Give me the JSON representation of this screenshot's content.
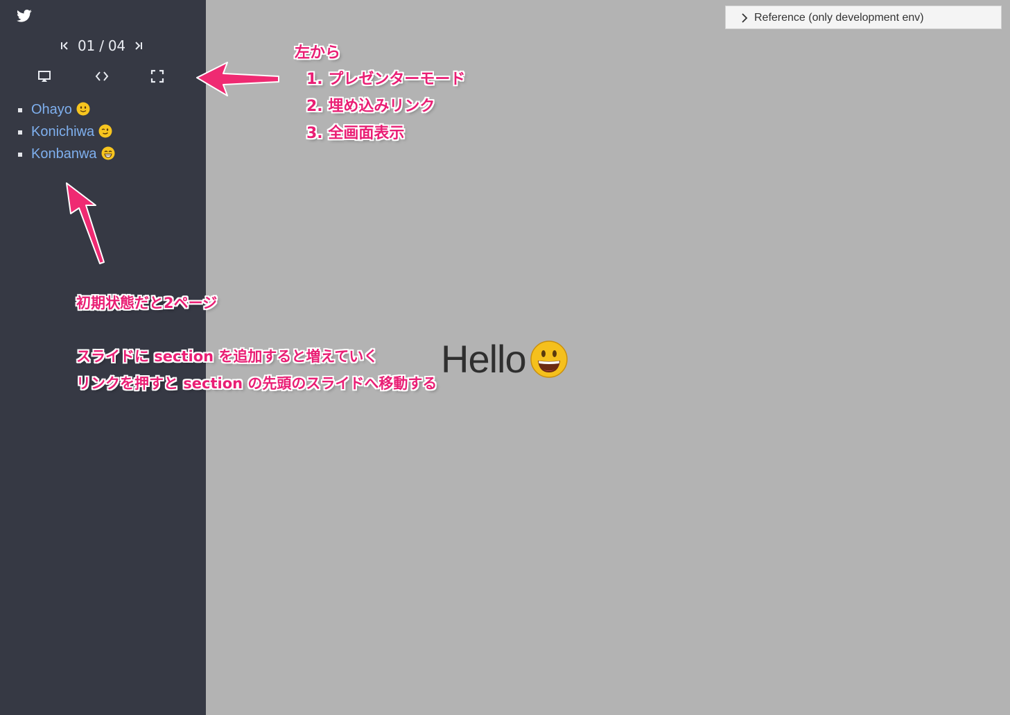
{
  "sidebar": {
    "icons": {
      "twitter": "twitter-bird-icon",
      "first": "skip-to-first-icon",
      "last": "skip-to-last-icon",
      "present": "presenter-mode-icon",
      "embed": "embed-code-icon",
      "fullscreen": "fullscreen-icon"
    },
    "pager": {
      "counter": "01 / 04"
    },
    "toc": [
      {
        "label": "Ohayo",
        "emoji": "slightly-smiling-face"
      },
      {
        "label": "Konichiwa",
        "emoji": "winking-face"
      },
      {
        "label": "Konbanwa",
        "emoji": "grinning-face-smiling-eyes"
      }
    ],
    "colors": {
      "background": "#363944",
      "link": "#7fb0ef"
    }
  },
  "reference": {
    "label": "Reference (only development env)",
    "icon": "chevron-right-icon"
  },
  "slide": {
    "text": "Hello",
    "emoji": "smiling-face-open-mouth",
    "background": "#b3b3b3"
  },
  "annotations": {
    "tools_heading": "左から",
    "tool_1": "1. プレゼンターモード",
    "tool_2": "2. 埋め込みリンク",
    "tool_3": "3. 全画面表示",
    "initial_pages": "初期状態だと2ページ",
    "section_add": "スライドに section を追加すると増えていく",
    "section_link": "リンクを押すと section の先頭のスライドへ移動する",
    "color": "#e91e74"
  }
}
